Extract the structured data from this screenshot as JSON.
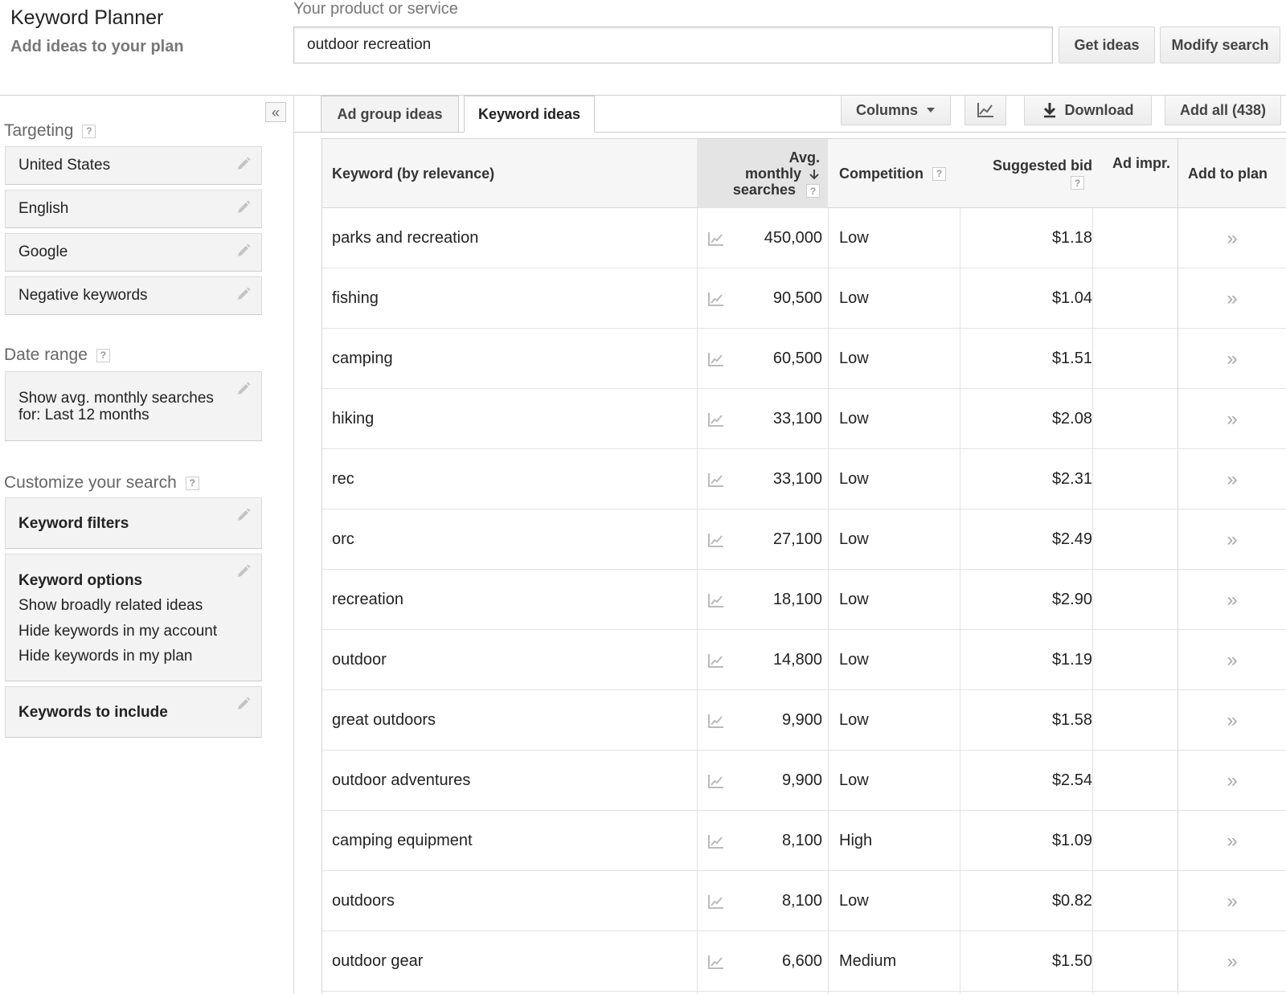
{
  "header": {
    "title": "Keyword Planner",
    "subtitle": "Add ideas to your plan",
    "search_label": "Your product or service",
    "search_value": "outdoor recreation",
    "get_ideas_label": "Get ideas",
    "modify_search_label": "Modify search"
  },
  "sidebar": {
    "collapse_icon": "«",
    "targeting_title": "Targeting",
    "targeting_items": [
      "United States",
      "English",
      "Google",
      "Negative keywords"
    ],
    "date_range_title": "Date range",
    "date_range_line1": "Show avg. monthly searches",
    "date_range_line2": "for: Last 12 months",
    "customize_title": "Customize your search",
    "keyword_filters_label": "Keyword filters",
    "keyword_options_label": "Keyword options",
    "keyword_options_items": [
      "Show broadly related ideas",
      "Hide keywords in my account",
      "Hide keywords in my plan"
    ],
    "keywords_include_label": "Keywords to include",
    "help_glyph": "?"
  },
  "tabs": {
    "ad_group_label": "Ad group ideas",
    "keyword_label": "Keyword ideas"
  },
  "toolbar": {
    "columns_label": "Columns",
    "download_label": "Download",
    "add_all_label": "Add all (438)"
  },
  "table": {
    "headers": {
      "keyword": "Keyword (by relevance)",
      "searches_line1": "Avg.",
      "searches_line2": "monthly",
      "searches_line3": "searches",
      "competition": "Competition",
      "bid": "Suggested bid",
      "impr": "Ad impr.",
      "add": "Add to plan"
    },
    "rows": [
      {
        "keyword": "parks and recreation",
        "searches": "450,000",
        "competition": "Low",
        "bid": "$1.18"
      },
      {
        "keyword": "fishing",
        "searches": "90,500",
        "competition": "Low",
        "bid": "$1.04"
      },
      {
        "keyword": "camping",
        "searches": "60,500",
        "competition": "Low",
        "bid": "$1.51"
      },
      {
        "keyword": "hiking",
        "searches": "33,100",
        "competition": "Low",
        "bid": "$2.08"
      },
      {
        "keyword": "rec",
        "searches": "33,100",
        "competition": "Low",
        "bid": "$2.31"
      },
      {
        "keyword": "orc",
        "searches": "27,100",
        "competition": "Low",
        "bid": "$2.49"
      },
      {
        "keyword": "recreation",
        "searches": "18,100",
        "competition": "Low",
        "bid": "$2.90"
      },
      {
        "keyword": "outdoor",
        "searches": "14,800",
        "competition": "Low",
        "bid": "$1.19"
      },
      {
        "keyword": "great outdoors",
        "searches": "9,900",
        "competition": "Low",
        "bid": "$1.58"
      },
      {
        "keyword": "outdoor adventures",
        "searches": "9,900",
        "competition": "Low",
        "bid": "$2.54"
      },
      {
        "keyword": "camping equipment",
        "searches": "8,100",
        "competition": "High",
        "bid": "$1.09"
      },
      {
        "keyword": "outdoors",
        "searches": "8,100",
        "competition": "Low",
        "bid": "$0.82"
      },
      {
        "keyword": "outdoor gear",
        "searches": "6,600",
        "competition": "Medium",
        "bid": "$1.50"
      }
    ],
    "add_glyph": "»"
  },
  "colors": {
    "text": "#222222",
    "muted": "#777777",
    "border": "#d6d6d6",
    "button_bg": "#f3f3f3"
  }
}
